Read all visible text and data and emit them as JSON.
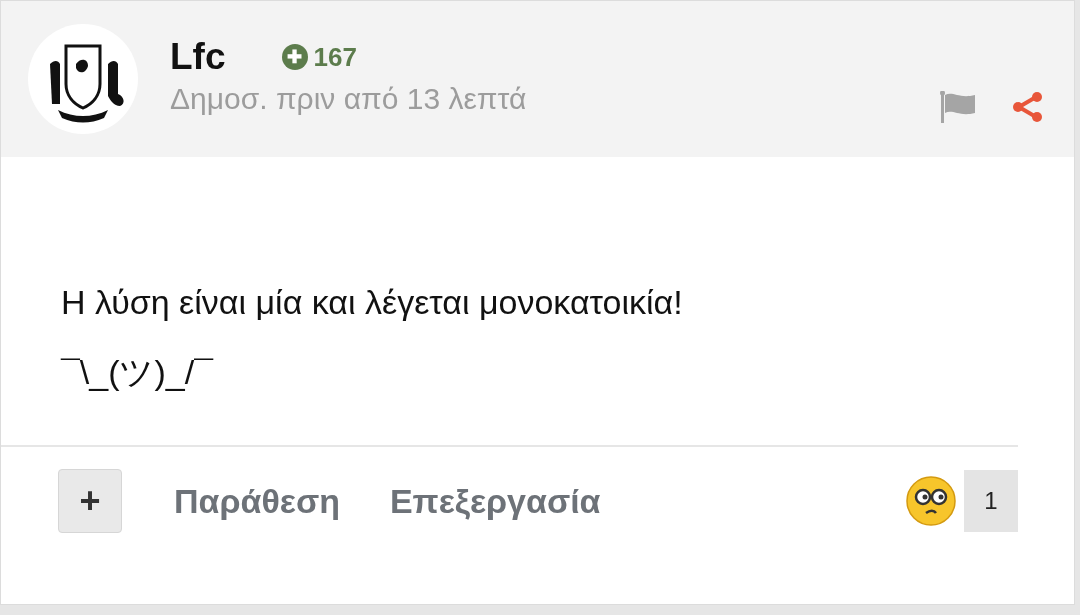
{
  "post": {
    "author": "Lfc",
    "reputation": {
      "icon": "✚",
      "value": "167"
    },
    "posted": "Δημοσ. πριν από 13 λεπτά",
    "body": [
      "Η λύση είναι μία και λέγεται μονοκατοικία!",
      "¯\\_(ツ)_/¯"
    ],
    "multiquote_button": "+",
    "actions": [
      "Παράθεση",
      "Επεξεργασία"
    ],
    "reaction": {
      "count": "1"
    }
  }
}
